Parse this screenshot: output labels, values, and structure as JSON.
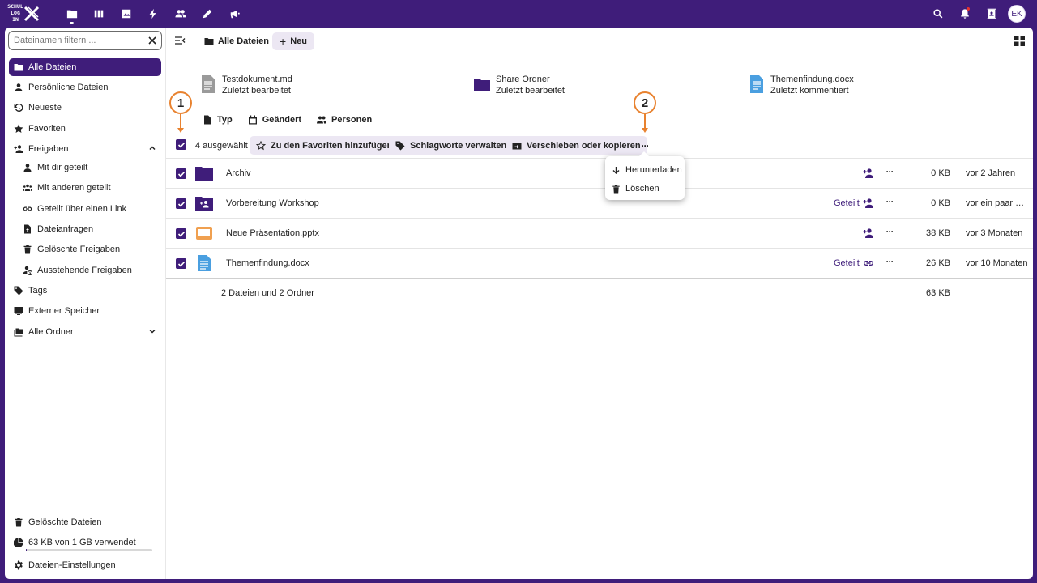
{
  "topbar": {
    "logo_text": [
      "SCHUL",
      "LOG",
      "IN"
    ],
    "apps": [
      "files-icon",
      "deck-icon",
      "photos-icon",
      "activity-icon",
      "contacts-icon",
      "notes-icon",
      "announcements-icon"
    ],
    "avatar_initials": "EK"
  },
  "sidebar": {
    "filter_placeholder": "Dateinamen filtern ...",
    "items": [
      {
        "label": "Alle Dateien",
        "icon": "folder-icon"
      },
      {
        "label": "Persönliche Dateien",
        "icon": "person-icon"
      },
      {
        "label": "Neueste",
        "icon": "history-icon"
      },
      {
        "label": "Favoriten",
        "icon": "star-icon"
      },
      {
        "label": "Freigaben",
        "icon": "share-icon"
      },
      {
        "label": "Mit dir geteilt",
        "icon": "person-icon"
      },
      {
        "label": "Mit anderen geteilt",
        "icon": "group-icon"
      },
      {
        "label": "Geteilt über einen Link",
        "icon": "link-icon"
      },
      {
        "label": "Dateianfragen",
        "icon": "file-upload-icon"
      },
      {
        "label": "Gelöschte Freigaben",
        "icon": "trash-icon"
      },
      {
        "label": "Ausstehende Freigaben",
        "icon": "pending-share-icon"
      },
      {
        "label": "Tags",
        "icon": "tag-icon"
      },
      {
        "label": "Externer Speicher",
        "icon": "monitor-icon"
      },
      {
        "label": "Alle Ordner",
        "icon": "folders-icon"
      }
    ],
    "deleted_files": "Gelöschte Dateien",
    "quota_text": "63 KB von 1 GB verwendet",
    "quota_fraction": 0.0001,
    "settings": "Dateien-Einstellungen"
  },
  "header": {
    "breadcrumb": "Alle Dateien",
    "new_button": "Neu"
  },
  "recent": [
    {
      "name": "Testdokument.md",
      "sub": "Zuletzt bearbeitet"
    },
    {
      "name": "Share Ordner",
      "sub": "Zuletzt bearbeitet"
    },
    {
      "name": "Themenfindung.docx",
      "sub": "Zuletzt kommentiert"
    }
  ],
  "filters": {
    "type": "Typ",
    "modified": "Geändert",
    "people": "Personen"
  },
  "selection": {
    "count": "4 ausgewählt",
    "favorite": "Zu den Favoriten hinzufügen",
    "tags": "Schlagworte verwalten",
    "move": "Verschieben oder kopieren",
    "more": "···"
  },
  "callouts": {
    "one": "1",
    "two": "2"
  },
  "files": [
    {
      "name": "Archiv",
      "shared": "",
      "size": "0 KB",
      "modified": "vor 2 Jahren"
    },
    {
      "name": "Vorbereitung Workshop",
      "shared": "Geteilt",
      "size": "0 KB",
      "modified": "vor ein paar Se..."
    },
    {
      "name": "Neue Präsentation.pptx",
      "shared": "",
      "size": "38 KB",
      "modified": "vor 3 Monaten"
    },
    {
      "name": "Themenfindung.docx",
      "shared": "Geteilt",
      "size": "26 KB",
      "modified": "vor 10 Monaten"
    }
  ],
  "summary": {
    "text": "2 Dateien und 2 Ordner",
    "size": "63 KB"
  },
  "menu": {
    "download": "Herunterladen",
    "delete": "Löschen"
  },
  "colors": {
    "brand": "#3f1d7a",
    "callout": "#e8822f",
    "doc_blue": "#4a9fe0",
    "ppt_orange": "#f0a050"
  }
}
